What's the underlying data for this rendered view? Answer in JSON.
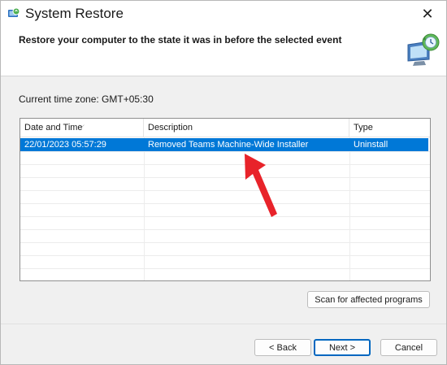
{
  "window": {
    "title": "System Restore",
    "close_glyph": "✕"
  },
  "header": {
    "headline": "Restore your computer to the state it was in before the selected event"
  },
  "timezone": "Current time zone: GMT+05:30",
  "table": {
    "columns": [
      "Date and Time",
      "Description",
      "Type"
    ],
    "sort_caret": "⌵",
    "rows": [
      {
        "date": "22/01/2023 05:57:29",
        "description": "Removed Teams Machine-Wide Installer",
        "type": "Uninstall"
      }
    ]
  },
  "buttons": {
    "scan": "Scan for affected programs",
    "back": "< Back",
    "next": "Next >",
    "cancel": "Cancel"
  },
  "colors": {
    "selection": "#0078d7",
    "annotation_arrow": "#e8232a"
  },
  "icons": {
    "app": "system-restore-icon",
    "hero": "system-restore-monitor-icon",
    "annotation": "red-pointer-arrow"
  }
}
